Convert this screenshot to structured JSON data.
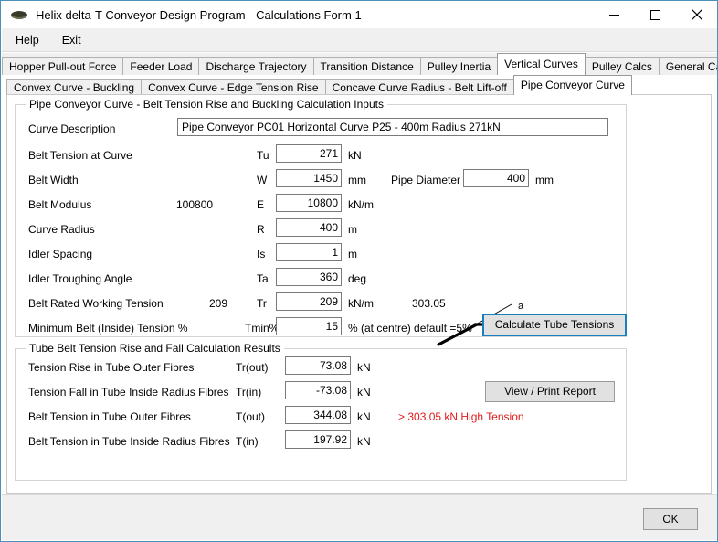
{
  "window": {
    "title": "Helix delta-T Conveyor Design Program - Calculations Form 1",
    "icon": "conveyor-pulley-icon",
    "minimize_label": "─",
    "maximize_label": "□",
    "close_label": "✕"
  },
  "menu": {
    "items": [
      {
        "label": "Help"
      },
      {
        "label": "Exit"
      }
    ]
  },
  "tabs": {
    "main": [
      {
        "label": "Hopper Pull-out Force",
        "selected": false
      },
      {
        "label": "Feeder Load",
        "selected": false
      },
      {
        "label": "Discharge Trajectory",
        "selected": false
      },
      {
        "label": "Transition Distance",
        "selected": false
      },
      {
        "label": "Pulley Inertia",
        "selected": false
      },
      {
        "label": "Vertical Curves",
        "selected": true
      },
      {
        "label": "Pulley Calcs",
        "selected": false
      },
      {
        "label": "General Calcs",
        "selected": false
      }
    ],
    "sub": [
      {
        "label": "Convex Curve - Buckling",
        "selected": false
      },
      {
        "label": "Convex Curve - Edge Tension Rise",
        "selected": false
      },
      {
        "label": "Concave Curve Radius - Belt Lift-off",
        "selected": false
      },
      {
        "label": "Pipe Conveyor Curve",
        "selected": true
      }
    ]
  },
  "inputs_group": {
    "title": "Pipe Conveyor Curve - Belt Tension Rise and Buckling Calculation Inputs",
    "rows": [
      {
        "label": "Curve Description",
        "symbol": "",
        "value": "Pipe Conveyor PC01 Horizontal Curve P25 - 400m Radius 271kN",
        "unit": "",
        "aux_left": ""
      },
      {
        "label": "Belt Tension at Curve",
        "symbol": "Tu",
        "value": "271",
        "unit": "kN",
        "aux_left": ""
      },
      {
        "label": "Belt Width",
        "symbol": "W",
        "value": "1450",
        "unit": "mm",
        "aux_left": ""
      },
      {
        "label": "Belt Modulus",
        "symbol": "E",
        "value": "10800",
        "unit": "kN/m",
        "aux_left": "100800"
      },
      {
        "label": "Curve Radius",
        "symbol": "R",
        "value": "400",
        "unit": "m",
        "aux_left": ""
      },
      {
        "label": "Idler Spacing",
        "symbol": "Is",
        "value": "1",
        "unit": "m",
        "aux_left": ""
      },
      {
        "label": "Idler Troughing Angle",
        "symbol": "Ta",
        "value": "360",
        "unit": "deg",
        "aux_left": ""
      },
      {
        "label": "Belt Rated Working Tension",
        "symbol": "Tr",
        "value": "209",
        "unit": "kN/m",
        "aux_left": "209"
      },
      {
        "label": "Minimum Belt (Inside) Tension %",
        "symbol": "Tmin%",
        "value": "15",
        "unit": "% (at centre) default =5%",
        "aux_left": ""
      }
    ],
    "pipe_diameter_label": "Pipe Diameter",
    "pipe_diameter_value": "400",
    "pipe_diameter_unit": "mm",
    "rated_tension_total": "303.05",
    "calculate_button_label": "Calculate Tube Tensions",
    "diagram_angle_label": "a"
  },
  "results_group": {
    "title": "Tube Belt Tension Rise and Fall Calculation Results",
    "rows": [
      {
        "label": "Tension Rise in Tube Outer Fibres",
        "symbol": "Tr(out)",
        "value": "73.08",
        "unit": "kN",
        "warning": ""
      },
      {
        "label": "Tension Fall in Tube Inside Radius Fibres",
        "symbol": "Tr(in)",
        "value": "-73.08",
        "unit": "kN",
        "warning": ""
      },
      {
        "label": "Belt Tension in Tube Outer Fibres",
        "symbol": "T(out)",
        "value": "344.08",
        "unit": "kN",
        "warning": "> 303.05 kN High Tension"
      },
      {
        "label": "Belt Tension in Tube Inside Radius Fibres",
        "symbol": "T(in)",
        "value": "197.92",
        "unit": "kN",
        "warning": ""
      }
    ],
    "report_button_label": "View / Print Report"
  },
  "footer": {
    "ok_label": "OK"
  },
  "colors": {
    "window_border": "#4a90b8",
    "focus_blue": "#1a7fc1",
    "warning_red": "#e01b1b",
    "control_gray": "#f0f0f0"
  }
}
